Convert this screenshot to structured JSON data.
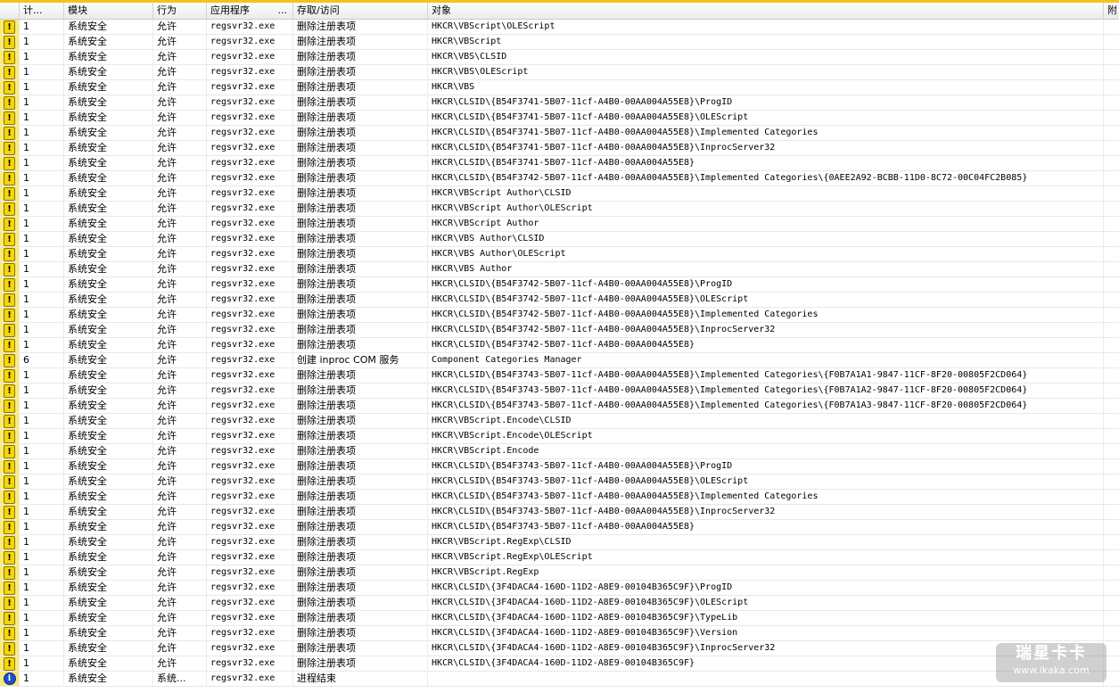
{
  "columns": {
    "count": "计...",
    "module": "模块",
    "action": "行为",
    "app": "应用程序",
    "app_more": "...",
    "access": "存取/访问",
    "object": "对象",
    "extra": "附"
  },
  "rows": [
    {
      "icon": "warning",
      "count": "1",
      "module": "系统安全",
      "action": "允许",
      "app": "regsvr32.exe",
      "access": "删除注册表项",
      "object": "HKCR\\VBScript\\OLEScript"
    },
    {
      "icon": "warning",
      "count": "1",
      "module": "系统安全",
      "action": "允许",
      "app": "regsvr32.exe",
      "access": "删除注册表项",
      "object": "HKCR\\VBScript"
    },
    {
      "icon": "warning",
      "count": "1",
      "module": "系统安全",
      "action": "允许",
      "app": "regsvr32.exe",
      "access": "删除注册表项",
      "object": "HKCR\\VBS\\CLSID"
    },
    {
      "icon": "warning",
      "count": "1",
      "module": "系统安全",
      "action": "允许",
      "app": "regsvr32.exe",
      "access": "删除注册表项",
      "object": "HKCR\\VBS\\OLEScript"
    },
    {
      "icon": "warning",
      "count": "1",
      "module": "系统安全",
      "action": "允许",
      "app": "regsvr32.exe",
      "access": "删除注册表项",
      "object": "HKCR\\VBS"
    },
    {
      "icon": "warning",
      "count": "1",
      "module": "系统安全",
      "action": "允许",
      "app": "regsvr32.exe",
      "access": "删除注册表项",
      "object": "HKCR\\CLSID\\{B54F3741-5B07-11cf-A4B0-00AA004A55E8}\\ProgID"
    },
    {
      "icon": "warning",
      "count": "1",
      "module": "系统安全",
      "action": "允许",
      "app": "regsvr32.exe",
      "access": "删除注册表项",
      "object": "HKCR\\CLSID\\{B54F3741-5B07-11cf-A4B0-00AA004A55E8}\\OLEScript"
    },
    {
      "icon": "warning",
      "count": "1",
      "module": "系统安全",
      "action": "允许",
      "app": "regsvr32.exe",
      "access": "删除注册表项",
      "object": "HKCR\\CLSID\\{B54F3741-5B07-11cf-A4B0-00AA004A55E8}\\Implemented Categories"
    },
    {
      "icon": "warning",
      "count": "1",
      "module": "系统安全",
      "action": "允许",
      "app": "regsvr32.exe",
      "access": "删除注册表项",
      "object": "HKCR\\CLSID\\{B54F3741-5B07-11cf-A4B0-00AA004A55E8}\\InprocServer32"
    },
    {
      "icon": "warning",
      "count": "1",
      "module": "系统安全",
      "action": "允许",
      "app": "regsvr32.exe",
      "access": "删除注册表项",
      "object": "HKCR\\CLSID\\{B54F3741-5B07-11cf-A4B0-00AA004A55E8}"
    },
    {
      "icon": "warning",
      "count": "1",
      "module": "系统安全",
      "action": "允许",
      "app": "regsvr32.exe",
      "access": "删除注册表项",
      "object": "HKCR\\CLSID\\{B54F3742-5B07-11cf-A4B0-00AA004A55E8}\\Implemented Categories\\{0AEE2A92-BCBB-11D0-8C72-00C04FC2B085}"
    },
    {
      "icon": "warning",
      "count": "1",
      "module": "系统安全",
      "action": "允许",
      "app": "regsvr32.exe",
      "access": "删除注册表项",
      "object": "HKCR\\VBScript Author\\CLSID"
    },
    {
      "icon": "warning",
      "count": "1",
      "module": "系统安全",
      "action": "允许",
      "app": "regsvr32.exe",
      "access": "删除注册表项",
      "object": "HKCR\\VBScript Author\\OLEScript"
    },
    {
      "icon": "warning",
      "count": "1",
      "module": "系统安全",
      "action": "允许",
      "app": "regsvr32.exe",
      "access": "删除注册表项",
      "object": "HKCR\\VBScript Author"
    },
    {
      "icon": "warning",
      "count": "1",
      "module": "系统安全",
      "action": "允许",
      "app": "regsvr32.exe",
      "access": "删除注册表项",
      "object": "HKCR\\VBS Author\\CLSID"
    },
    {
      "icon": "warning",
      "count": "1",
      "module": "系统安全",
      "action": "允许",
      "app": "regsvr32.exe",
      "access": "删除注册表项",
      "object": "HKCR\\VBS Author\\OLEScript"
    },
    {
      "icon": "warning",
      "count": "1",
      "module": "系统安全",
      "action": "允许",
      "app": "regsvr32.exe",
      "access": "删除注册表项",
      "object": "HKCR\\VBS Author"
    },
    {
      "icon": "warning",
      "count": "1",
      "module": "系统安全",
      "action": "允许",
      "app": "regsvr32.exe",
      "access": "删除注册表项",
      "object": "HKCR\\CLSID\\{B54F3742-5B07-11cf-A4B0-00AA004A55E8}\\ProgID"
    },
    {
      "icon": "warning",
      "count": "1",
      "module": "系统安全",
      "action": "允许",
      "app": "regsvr32.exe",
      "access": "删除注册表项",
      "object": "HKCR\\CLSID\\{B54F3742-5B07-11cf-A4B0-00AA004A55E8}\\OLEScript"
    },
    {
      "icon": "warning",
      "count": "1",
      "module": "系统安全",
      "action": "允许",
      "app": "regsvr32.exe",
      "access": "删除注册表项",
      "object": "HKCR\\CLSID\\{B54F3742-5B07-11cf-A4B0-00AA004A55E8}\\Implemented Categories"
    },
    {
      "icon": "warning",
      "count": "1",
      "module": "系统安全",
      "action": "允许",
      "app": "regsvr32.exe",
      "access": "删除注册表项",
      "object": "HKCR\\CLSID\\{B54F3742-5B07-11cf-A4B0-00AA004A55E8}\\InprocServer32"
    },
    {
      "icon": "warning",
      "count": "1",
      "module": "系统安全",
      "action": "允许",
      "app": "regsvr32.exe",
      "access": "删除注册表项",
      "object": "HKCR\\CLSID\\{B54F3742-5B07-11cf-A4B0-00AA004A55E8}"
    },
    {
      "icon": "warning",
      "count": "6",
      "module": "系统安全",
      "action": "允许",
      "app": "regsvr32.exe",
      "access": "创建 inproc COM 服务",
      "object": "Component Categories Manager"
    },
    {
      "icon": "warning",
      "count": "1",
      "module": "系统安全",
      "action": "允许",
      "app": "regsvr32.exe",
      "access": "删除注册表项",
      "object": "HKCR\\CLSID\\{B54F3743-5B07-11cf-A4B0-00AA004A55E8}\\Implemented Categories\\{F0B7A1A1-9847-11CF-8F20-00805F2CD064}"
    },
    {
      "icon": "warning",
      "count": "1",
      "module": "系统安全",
      "action": "允许",
      "app": "regsvr32.exe",
      "access": "删除注册表项",
      "object": "HKCR\\CLSID\\{B54F3743-5B07-11cf-A4B0-00AA004A55E8}\\Implemented Categories\\{F0B7A1A2-9847-11CF-8F20-00805F2CD064}"
    },
    {
      "icon": "warning",
      "count": "1",
      "module": "系统安全",
      "action": "允许",
      "app": "regsvr32.exe",
      "access": "删除注册表项",
      "object": "HKCR\\CLSID\\{B54F3743-5B07-11cf-A4B0-00AA004A55E8}\\Implemented Categories\\{F0B7A1A3-9847-11CF-8F20-00805F2CD064}"
    },
    {
      "icon": "warning",
      "count": "1",
      "module": "系统安全",
      "action": "允许",
      "app": "regsvr32.exe",
      "access": "删除注册表项",
      "object": "HKCR\\VBScript.Encode\\CLSID"
    },
    {
      "icon": "warning",
      "count": "1",
      "module": "系统安全",
      "action": "允许",
      "app": "regsvr32.exe",
      "access": "删除注册表项",
      "object": "HKCR\\VBScript.Encode\\OLEScript"
    },
    {
      "icon": "warning",
      "count": "1",
      "module": "系统安全",
      "action": "允许",
      "app": "regsvr32.exe",
      "access": "删除注册表项",
      "object": "HKCR\\VBScript.Encode"
    },
    {
      "icon": "warning",
      "count": "1",
      "module": "系统安全",
      "action": "允许",
      "app": "regsvr32.exe",
      "access": "删除注册表项",
      "object": "HKCR\\CLSID\\{B54F3743-5B07-11cf-A4B0-00AA004A55E8}\\ProgID"
    },
    {
      "icon": "warning",
      "count": "1",
      "module": "系统安全",
      "action": "允许",
      "app": "regsvr32.exe",
      "access": "删除注册表项",
      "object": "HKCR\\CLSID\\{B54F3743-5B07-11cf-A4B0-00AA004A55E8}\\OLEScript"
    },
    {
      "icon": "warning",
      "count": "1",
      "module": "系统安全",
      "action": "允许",
      "app": "regsvr32.exe",
      "access": "删除注册表项",
      "object": "HKCR\\CLSID\\{B54F3743-5B07-11cf-A4B0-00AA004A55E8}\\Implemented Categories"
    },
    {
      "icon": "warning",
      "count": "1",
      "module": "系统安全",
      "action": "允许",
      "app": "regsvr32.exe",
      "access": "删除注册表项",
      "object": "HKCR\\CLSID\\{B54F3743-5B07-11cf-A4B0-00AA004A55E8}\\InprocServer32"
    },
    {
      "icon": "warning",
      "count": "1",
      "module": "系统安全",
      "action": "允许",
      "app": "regsvr32.exe",
      "access": "删除注册表项",
      "object": "HKCR\\CLSID\\{B54F3743-5B07-11cf-A4B0-00AA004A55E8}"
    },
    {
      "icon": "warning",
      "count": "1",
      "module": "系统安全",
      "action": "允许",
      "app": "regsvr32.exe",
      "access": "删除注册表项",
      "object": "HKCR\\VBScript.RegExp\\CLSID"
    },
    {
      "icon": "warning",
      "count": "1",
      "module": "系统安全",
      "action": "允许",
      "app": "regsvr32.exe",
      "access": "删除注册表项",
      "object": "HKCR\\VBScript.RegExp\\OLEScript"
    },
    {
      "icon": "warning",
      "count": "1",
      "module": "系统安全",
      "action": "允许",
      "app": "regsvr32.exe",
      "access": "删除注册表项",
      "object": "HKCR\\VBScript.RegExp"
    },
    {
      "icon": "warning",
      "count": "1",
      "module": "系统安全",
      "action": "允许",
      "app": "regsvr32.exe",
      "access": "删除注册表项",
      "object": "HKCR\\CLSID\\{3F4DACA4-160D-11D2-A8E9-00104B365C9F}\\ProgID"
    },
    {
      "icon": "warning",
      "count": "1",
      "module": "系统安全",
      "action": "允许",
      "app": "regsvr32.exe",
      "access": "删除注册表项",
      "object": "HKCR\\CLSID\\{3F4DACA4-160D-11D2-A8E9-00104B365C9F}\\OLEScript"
    },
    {
      "icon": "warning",
      "count": "1",
      "module": "系统安全",
      "action": "允许",
      "app": "regsvr32.exe",
      "access": "删除注册表项",
      "object": "HKCR\\CLSID\\{3F4DACA4-160D-11D2-A8E9-00104B365C9F}\\TypeLib"
    },
    {
      "icon": "warning",
      "count": "1",
      "module": "系统安全",
      "action": "允许",
      "app": "regsvr32.exe",
      "access": "删除注册表项",
      "object": "HKCR\\CLSID\\{3F4DACA4-160D-11D2-A8E9-00104B365C9F}\\Version"
    },
    {
      "icon": "warning",
      "count": "1",
      "module": "系统安全",
      "action": "允许",
      "app": "regsvr32.exe",
      "access": "删除注册表项",
      "object": "HKCR\\CLSID\\{3F4DACA4-160D-11D2-A8E9-00104B365C9F}\\InprocServer32"
    },
    {
      "icon": "warning",
      "count": "1",
      "module": "系统安全",
      "action": "允许",
      "app": "regsvr32.exe",
      "access": "删除注册表项",
      "object": "HKCR\\CLSID\\{3F4DACA4-160D-11D2-A8E9-00104B365C9F}"
    },
    {
      "icon": "info",
      "count": "1",
      "module": "系统安全",
      "action": "系统...",
      "app": "regsvr32.exe",
      "access": "进程结束",
      "object": ""
    }
  ],
  "icons": {
    "warning_glyph": "!",
    "info_glyph": "i"
  },
  "watermark": {
    "title": "瑞星卡卡",
    "url": "www.ikaka.com"
  },
  "colors": {
    "icon_column": "#fbe97c",
    "warning": "#f5d60a",
    "info": "#1d4fd0",
    "top_stripe": "#f4c21b"
  }
}
